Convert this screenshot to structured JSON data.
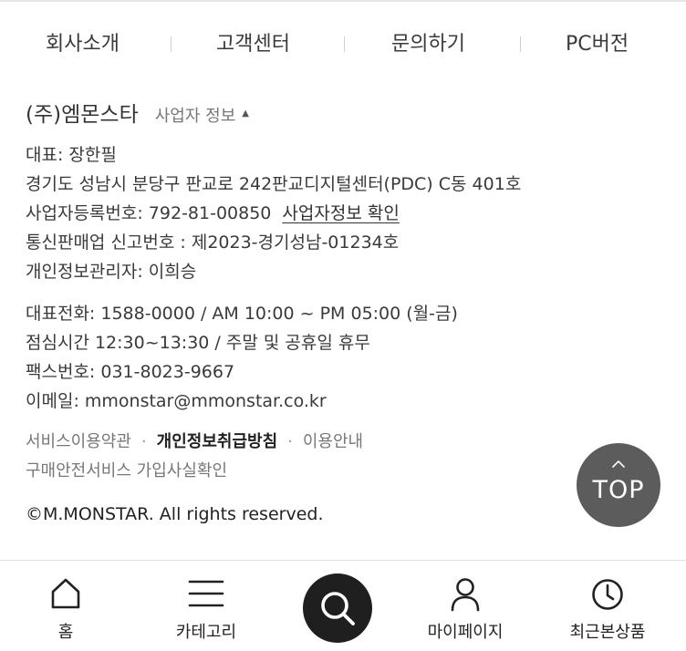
{
  "footer_nav": {
    "about": "회사소개",
    "support": "고객센터",
    "inquiry": "문의하기",
    "pc_version": "PC버전"
  },
  "company": {
    "name": "(주)엠몬스타",
    "business_info_toggle": "사업자 정보",
    "toggle_indicator": "▲"
  },
  "business_info": {
    "ceo": "대표: 장한필",
    "address": "경기도 성남시 분당구 판교로 242판교디지털센터(PDC) C동 401호",
    "registration_number": "사업자등록번호: 792-81-00850",
    "registration_check_link": "사업자정보 확인",
    "ecommerce_number": "통신판매업 신고번호 : 제2023-경기성남-01234호",
    "privacy_manager": "개인정보관리자: 이희승"
  },
  "contact": {
    "phone": "대표전화: 1588-0000 / AM 10:00 ~ PM 05:00 (월-금)",
    "lunch": "점심시간 12:30~13:30 /  주말 및 공휴일 휴무",
    "fax": "팩스번호: 031-8023-9667",
    "email": "이메일: mmonstar@mmonstar.co.kr"
  },
  "policies": {
    "terms": "서비스이용약관",
    "privacy_policy": "개인정보취급방침",
    "guide": "이용안내",
    "separator": "·",
    "escrow_verify": "구매안전서비스 가입사실확인"
  },
  "copyright": "©M.MONSTAR. All rights reserved.",
  "top_button": {
    "label": "TOP",
    "icon": "chevron-up-icon"
  },
  "bottom_nav": {
    "home": {
      "label": "홈",
      "icon": "home-icon"
    },
    "category": {
      "label": "카테고리",
      "icon": "menu-icon"
    },
    "search": {
      "icon": "search-icon"
    },
    "mypage": {
      "label": "마이페이지",
      "icon": "user-icon"
    },
    "recent": {
      "label": "최근본상품",
      "icon": "clock-icon"
    }
  },
  "colors": {
    "text_primary": "#333333",
    "text_secondary": "#777777",
    "top_button_bg": "#5c5c5c",
    "search_button_bg": "#1f1f1f"
  }
}
